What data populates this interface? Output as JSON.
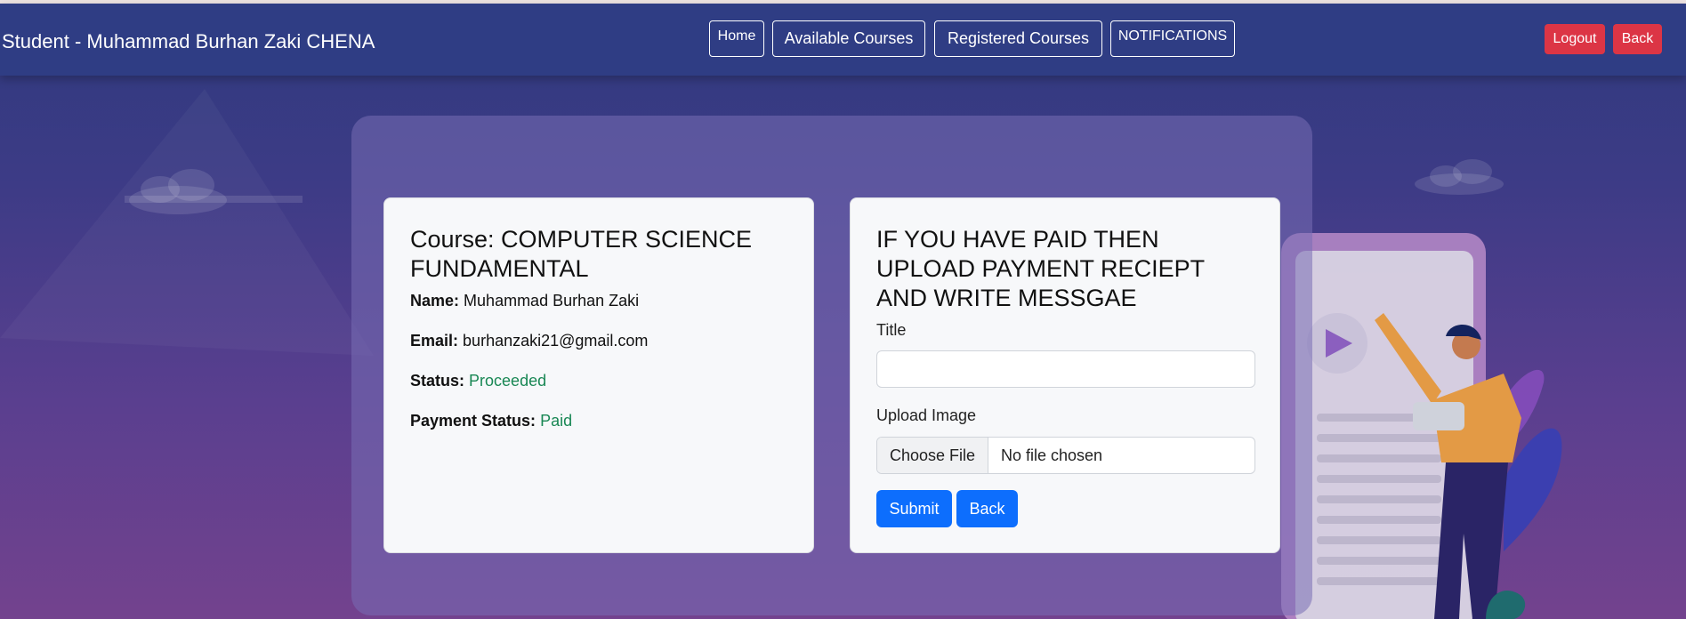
{
  "navbar": {
    "brand": "Student - Muhammad Burhan Zaki CHENA",
    "links": {
      "home": "Home",
      "available_courses": "Available Courses",
      "registered_courses": "Registered Courses",
      "notifications": "NOTIFICATIONS"
    },
    "logout": "Logout",
    "back": "Back"
  },
  "course_card": {
    "title": "Course: COMPUTER SCIENCE FUNDAMENTAL",
    "name_label": "Name:",
    "name_value": "Muhammad Burhan Zaki",
    "email_label": "Email:",
    "email_value": "burhanzaki21@gmail.com",
    "status_label": "Status:",
    "status_value": "Proceeded",
    "payment_label": "Payment Status:",
    "payment_value": "Paid"
  },
  "upload_card": {
    "heading": "IF YOU HAVE PAID THEN UPLOAD PAYMENT RECIEPT AND WRITE MESSGAE",
    "title_label": "Title",
    "title_value": "",
    "upload_label": "Upload Image",
    "choose_file": "Choose File",
    "no_file": "No file chosen",
    "submit": "Submit",
    "back": "Back"
  },
  "colors": {
    "navbar": "#2f3d84",
    "danger": "#dc3545",
    "primary": "#0d6efd",
    "success": "#198754"
  }
}
